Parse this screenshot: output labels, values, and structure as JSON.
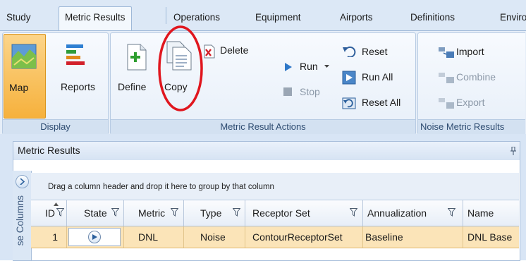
{
  "tabs": [
    "Study",
    "Metric Results",
    "Operations",
    "Equipment",
    "Airports",
    "Definitions",
    "Enviro"
  ],
  "display_group": {
    "title": "Display",
    "map": "Map",
    "reports": "Reports"
  },
  "actions_group": {
    "title": "Metric Result Actions",
    "define": "Define",
    "copy": "Copy",
    "delete": "Delete",
    "run": "Run",
    "stop": "Stop",
    "reset": "Reset",
    "run_all": "Run All",
    "reset_all": "Reset All"
  },
  "noise_group": {
    "title": "Noise Metric Results",
    "import": "Import",
    "combine": "Combine",
    "export": "Export"
  },
  "panel": {
    "title": "Metric Results",
    "pin": "p",
    "side_label": "se Columns",
    "group_hint": "Drag a column header and drop it here to group by that column"
  },
  "columns": [
    "ID",
    "State",
    "Metric",
    "Type",
    "Receptor Set",
    "Annualization",
    "Name"
  ],
  "rows": [
    {
      "id": "1",
      "metric": "DNL",
      "type": "Noise",
      "receptor_set": "ContourReceptorSet",
      "annualization": "Baseline",
      "name": "DNL Base"
    }
  ],
  "colors": {
    "accent_map": "#f6b13c",
    "annotation": "#e0161e",
    "selected_row": "#fbe4b8"
  }
}
